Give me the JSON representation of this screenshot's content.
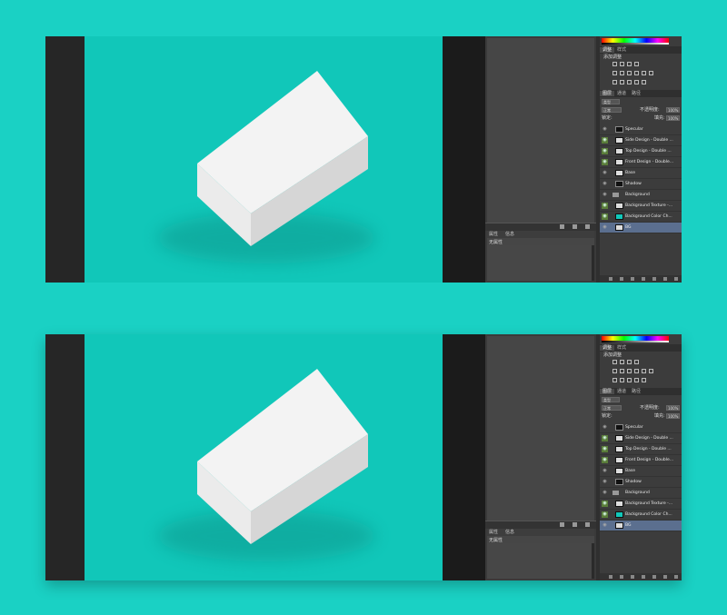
{
  "colors": {
    "background": "#1ad1c4",
    "canvas": "#11c7b9",
    "selected_layer": "#5b6f8f",
    "visible_eye": "#5a7d3a"
  },
  "panels": {
    "adjust_tabs": [
      "调整",
      "样式"
    ],
    "add_adjustment": "添加调整",
    "layer_tabs": [
      "图层",
      "通道",
      "路径"
    ],
    "kind_filter": "类型",
    "blend_mode": "正常",
    "opacity_label": "不透明度:",
    "opacity_value": "100%",
    "lock_label": "锁定:",
    "fill_label": "填充:",
    "fill_value": "100%",
    "properties_tabs": [
      "属性",
      "信息"
    ],
    "no_properties": "无属性"
  },
  "layers": [
    {
      "name": "Specular",
      "thumb": "dark",
      "visible": true,
      "green": false,
      "indent": false,
      "folder": false,
      "selected": false
    },
    {
      "name": "Side Design - Double ...",
      "thumb": "light",
      "visible": true,
      "green": true,
      "indent": true,
      "folder": false,
      "selected": false
    },
    {
      "name": "Top Design - Double ...",
      "thumb": "light",
      "visible": true,
      "green": true,
      "indent": true,
      "folder": false,
      "selected": false
    },
    {
      "name": "Front Design - Double...",
      "thumb": "light",
      "visible": true,
      "green": true,
      "indent": true,
      "folder": false,
      "selected": false
    },
    {
      "name": "Base",
      "thumb": "light",
      "visible": true,
      "green": false,
      "indent": false,
      "folder": false,
      "selected": false
    },
    {
      "name": "Shadow",
      "thumb": "dark",
      "visible": true,
      "green": false,
      "indent": false,
      "folder": false,
      "selected": false
    },
    {
      "name": "Background",
      "thumb": "none",
      "visible": true,
      "green": false,
      "indent": false,
      "folder": true,
      "selected": false
    },
    {
      "name": "Background Texture -...",
      "thumb": "light",
      "visible": true,
      "green": true,
      "indent": true,
      "folder": false,
      "selected": false
    },
    {
      "name": "Background Color Ch...",
      "thumb": "teal",
      "visible": true,
      "green": true,
      "indent": true,
      "folder": false,
      "selected": false
    },
    {
      "name": "BG",
      "thumb": "light",
      "visible": true,
      "green": false,
      "indent": false,
      "folder": false,
      "selected": true
    }
  ]
}
